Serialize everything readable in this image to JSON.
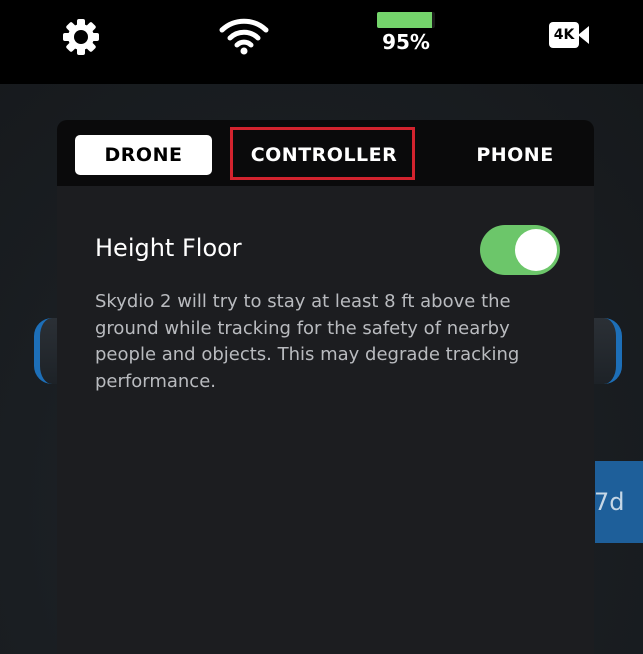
{
  "status_bar": {
    "settings_icon": "gear-icon",
    "wifi_icon": "wifi-icon",
    "battery": {
      "percent_label": "95%",
      "level": 0.95,
      "color": "#74d46b"
    },
    "camera": {
      "icon": "camera-icon",
      "resolution_label": "4K"
    }
  },
  "background": {
    "partial_text": "7d",
    "accent": "#1d6fb8"
  },
  "tabs": [
    {
      "label": "DRONE",
      "selected": true
    },
    {
      "label": "CONTROLLER",
      "selected": false,
      "highlighted": true
    },
    {
      "label": "PHONE",
      "selected": false
    }
  ],
  "setting": {
    "title": "Height Floor",
    "enabled": true,
    "toggle_color": "#6cc66a",
    "description": "Skydio 2 will try to stay at least 8 ft above the ground while tracking for the safety of nearby people and objects. This may degrade tracking performance."
  },
  "colors": {
    "highlight_border": "#d3232e"
  }
}
